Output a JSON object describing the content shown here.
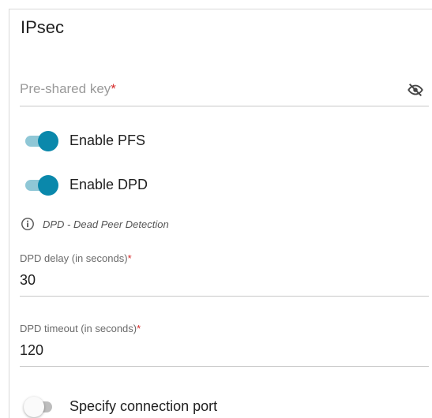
{
  "section": {
    "title": "IPsec"
  },
  "psk": {
    "placeholder": "Pre-shared key",
    "required_mark": "*",
    "visibility_icon": "eye-off-icon"
  },
  "toggles": {
    "pfs": {
      "label": "Enable PFS",
      "state": "on"
    },
    "dpd": {
      "label": "Enable DPD",
      "state": "on"
    },
    "port": {
      "label": "Specify connection port",
      "state": "off"
    }
  },
  "info": {
    "icon": "info-icon",
    "text": "DPD - Dead Peer Detection"
  },
  "dpd_delay": {
    "label": "DPD delay (in seconds)",
    "required_mark": "*",
    "value": "30"
  },
  "dpd_timeout": {
    "label": "DPD timeout (in seconds)",
    "required_mark": "*",
    "value": "120"
  },
  "colors": {
    "accent": "#0a88ab",
    "accent_track": "#8fc7d6",
    "required": "#d62b2b"
  }
}
